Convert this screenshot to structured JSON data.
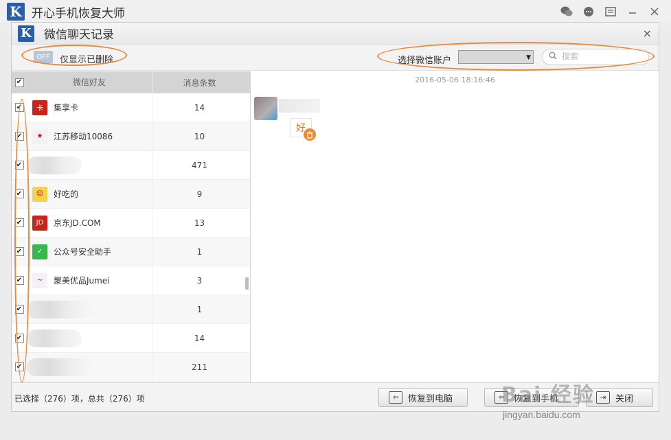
{
  "app": {
    "logo_letter": "K",
    "title": "开心手机恢复大师",
    "controls": [
      "wechat-icon",
      "chat-icon",
      "menu-icon",
      "minimize-icon",
      "close-icon"
    ]
  },
  "dialog": {
    "logo_letter": "K",
    "title": "微信聊天记录",
    "close_glyph": "×"
  },
  "toolbar": {
    "toggle_state": "OFF",
    "toggle_label": "仅显示已删除",
    "account_label": "选择微信账户",
    "search_placeholder": "搜索"
  },
  "friends_table": {
    "col_name": "微信好友",
    "col_count": "消息条数",
    "rows": [
      {
        "name": "集享卡",
        "count": "14",
        "avatar_color": "#c8241c",
        "avatar_glyph": "卡"
      },
      {
        "name": "江苏移动10086",
        "count": "10",
        "avatar_color": "#f2f2f2",
        "avatar_glyph": "★"
      },
      {
        "name": "",
        "count": "471",
        "avatar_color": "",
        "avatar_glyph": ""
      },
      {
        "name": "好吃的",
        "count": "9",
        "avatar_color": "#f4d14e",
        "avatar_glyph": "☺"
      },
      {
        "name": "京东JD.COM",
        "count": "13",
        "avatar_color": "#c8241c",
        "avatar_glyph": "JD"
      },
      {
        "name": "公众号安全助手",
        "count": "1",
        "avatar_color": "#36b94a",
        "avatar_glyph": "✓"
      },
      {
        "name": "聚美优品Jumei",
        "count": "3",
        "avatar_color": "#f5f0f5",
        "avatar_glyph": "~"
      },
      {
        "name": "",
        "count": "1",
        "avatar_color": "",
        "avatar_glyph": ""
      },
      {
        "name": "",
        "count": "14",
        "avatar_color": "",
        "avatar_glyph": ""
      },
      {
        "name": "",
        "count": "211",
        "avatar_color": "",
        "avatar_glyph": ""
      }
    ]
  },
  "chat": {
    "timestamp": "2016-05-06 18:16:46",
    "message_text": "好"
  },
  "footer": {
    "summary": "已选择（276）项，总共（276）项",
    "btn_restore_pc": "恢复到电脑",
    "btn_restore_phone": "恢复到手机",
    "btn_close": "关闭"
  },
  "watermark": {
    "main": "Bai 经验",
    "sub": "jingyan.baidu.com"
  },
  "colors": {
    "accent": "#2a5fa8",
    "highlight_oval": "#e98a3a",
    "trash": "#f08a2e"
  }
}
